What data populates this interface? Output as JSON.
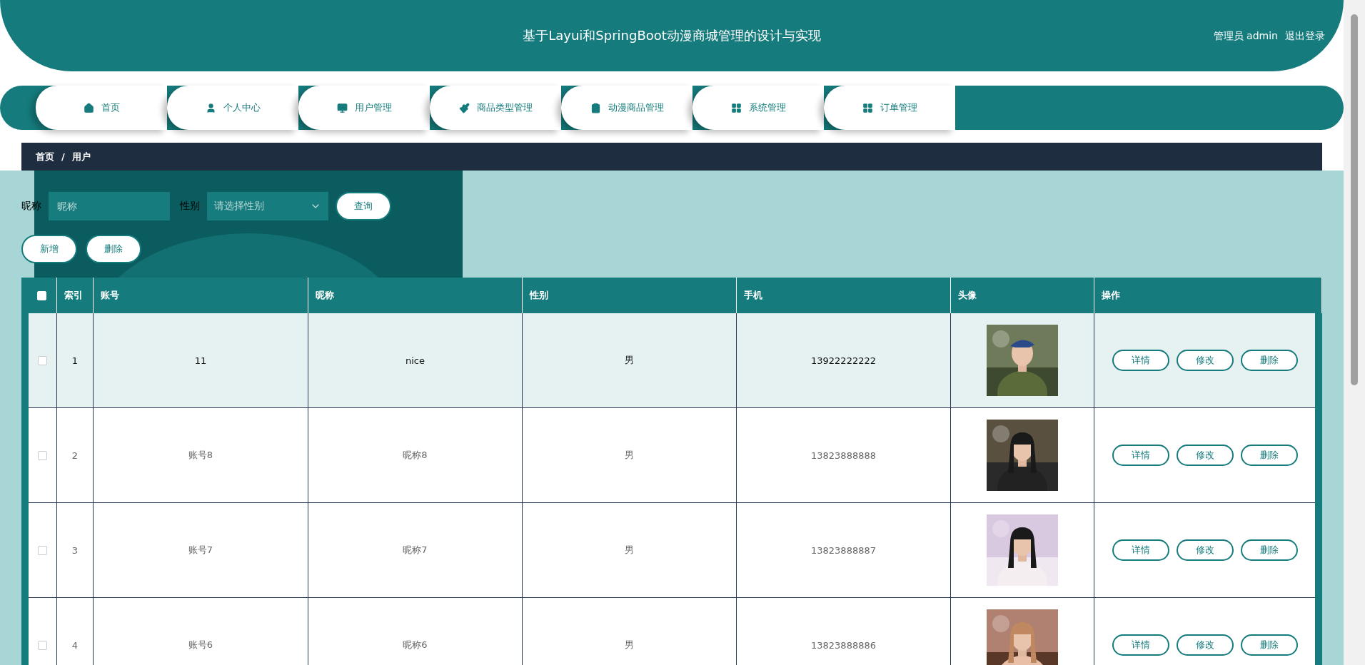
{
  "header": {
    "title": "基于Layui和SpringBoot动漫商城管理的设计与实现",
    "user": "管理员 admin",
    "logout": "退出登录"
  },
  "nav": [
    {
      "label": "首页"
    },
    {
      "label": "个人中心"
    },
    {
      "label": "用户管理"
    },
    {
      "label": "商品类型管理"
    },
    {
      "label": "动漫商品管理"
    },
    {
      "label": "系统管理"
    },
    {
      "label": "订单管理"
    }
  ],
  "breadcrumb": {
    "items": [
      "首页",
      "用户"
    ],
    "separator": "/"
  },
  "search": {
    "nickname_label": "昵称",
    "nickname_placeholder": "昵称",
    "gender_label": "性别",
    "gender_placeholder": "请选择性别",
    "query": "查询"
  },
  "actions": [
    "新增",
    "删除"
  ],
  "table": {
    "all_checked": false,
    "columns": [
      "索引",
      "账号",
      "昵称",
      "性别",
      "手机",
      "头像",
      "操作"
    ],
    "rows": [
      {
        "checked": false,
        "highlighted": true,
        "index": "1",
        "account": "11",
        "nickname": "nice",
        "gender": "男",
        "phone": "13922222222",
        "avatar": {
          "kind": "picture"
        },
        "buttons": [
          "详情",
          "修改",
          "删除"
        ]
      },
      {
        "checked": false,
        "highlighted": false,
        "index": "2",
        "account": "账号8",
        "nickname": "昵称8",
        "gender": "男",
        "phone": "13823888888",
        "avatar": {
          "kind": "picture"
        },
        "buttons": [
          "详情",
          "修改",
          "删除"
        ]
      },
      {
        "checked": false,
        "highlighted": false,
        "index": "3",
        "account": "账号7",
        "nickname": "昵称7",
        "gender": "男",
        "phone": "13823888887",
        "avatar": {
          "kind": "picture"
        },
        "buttons": [
          "详情",
          "修改",
          "删除"
        ]
      },
      {
        "checked": false,
        "highlighted": false,
        "index": "4",
        "account": "账号6",
        "nickname": "昵称6",
        "gender": "男",
        "phone": "13823888886",
        "avatar": {
          "kind": "picture"
        },
        "buttons": [
          "详情",
          "修改",
          "删除"
        ]
      }
    ]
  }
}
